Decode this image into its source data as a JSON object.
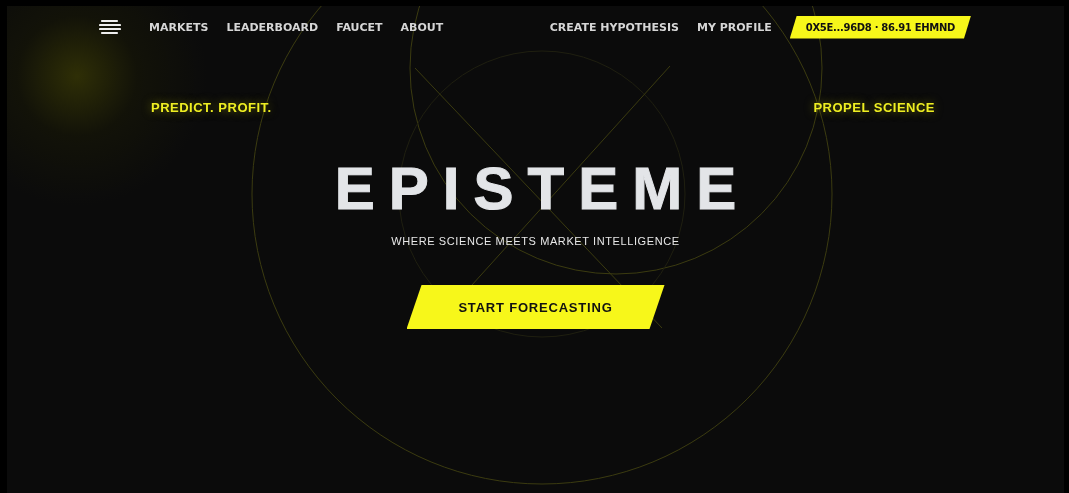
{
  "nav": {
    "left_links": [
      "MARKETS",
      "LEADERBOARD",
      "FAUCET",
      "ABOUT"
    ],
    "right_links": [
      "CREATE HYPOTHESIS",
      "MY PROFILE"
    ],
    "wallet": "0X5E...96D8 · 86.91 EHMND"
  },
  "hero": {
    "tagline_left": "PREDICT. PROFIT.",
    "tagline_right": "PROPEL SCIENCE",
    "title": "EPISTEME",
    "subtitle": "WHERE SCIENCE MEETS MARKET INTELLIGENCE",
    "cta": "START FORECASTING"
  }
}
